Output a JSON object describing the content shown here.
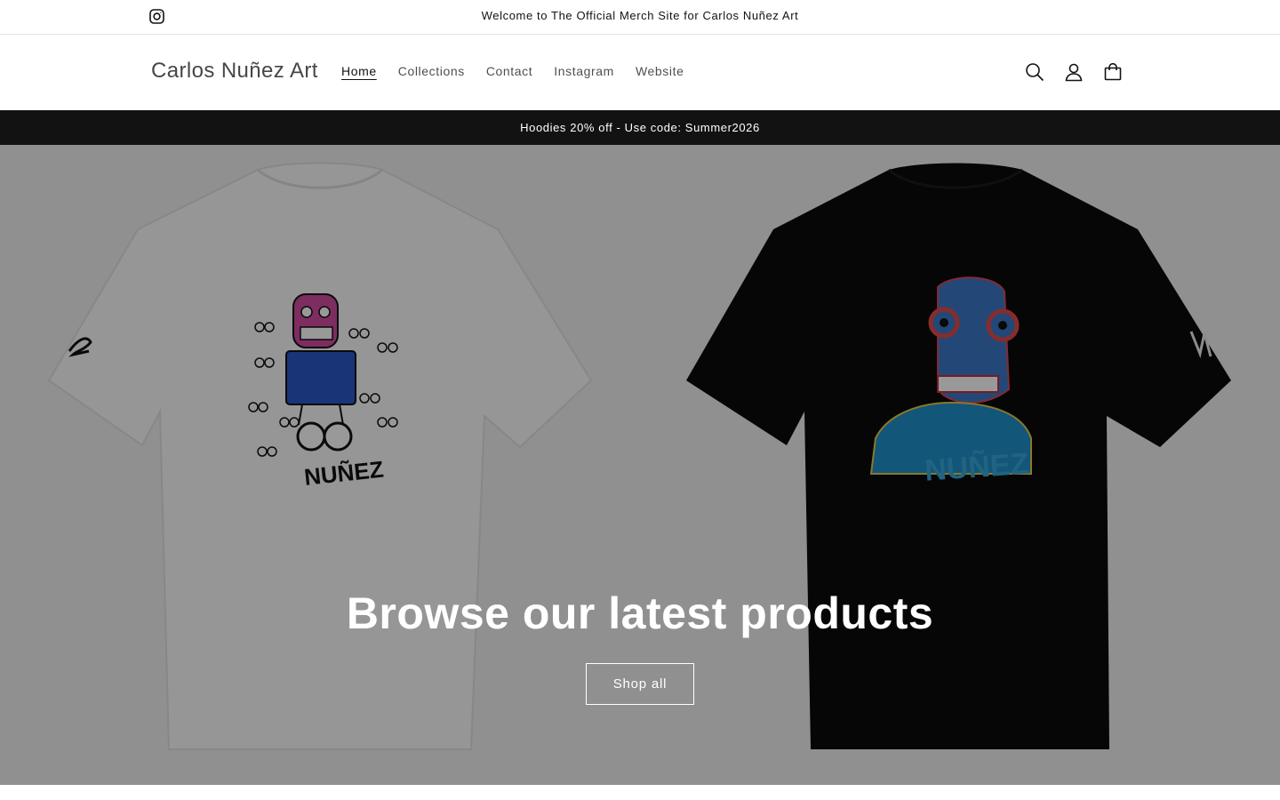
{
  "announcement": {
    "message": "Welcome to The Official Merch Site for Carlos Nuñez Art",
    "social_icon": "instagram-icon"
  },
  "header": {
    "brand": "Carlos Nuñez Art",
    "nav": [
      {
        "label": "Home",
        "active": true
      },
      {
        "label": "Collections",
        "active": false
      },
      {
        "label": "Contact",
        "active": false
      },
      {
        "label": "Instagram",
        "active": false
      },
      {
        "label": "Website",
        "active": false
      }
    ],
    "icons": [
      "search-icon",
      "account-icon",
      "cart-icon"
    ]
  },
  "promo": {
    "text": "Hoodies 20% off - Use code: Summer2026"
  },
  "hero": {
    "headline": "Browse our latest products",
    "cta_label": "Shop all",
    "images": [
      {
        "name": "white-tshirt-image",
        "print_text": "NUÑEZ"
      },
      {
        "name": "black-tshirt-image",
        "print_text": "NUÑEZ"
      }
    ]
  },
  "colors": {
    "text": "#121212",
    "promo_bg": "#121212",
    "overlay": "rgba(0,0,0,0.40)",
    "white": "#ffffff"
  }
}
